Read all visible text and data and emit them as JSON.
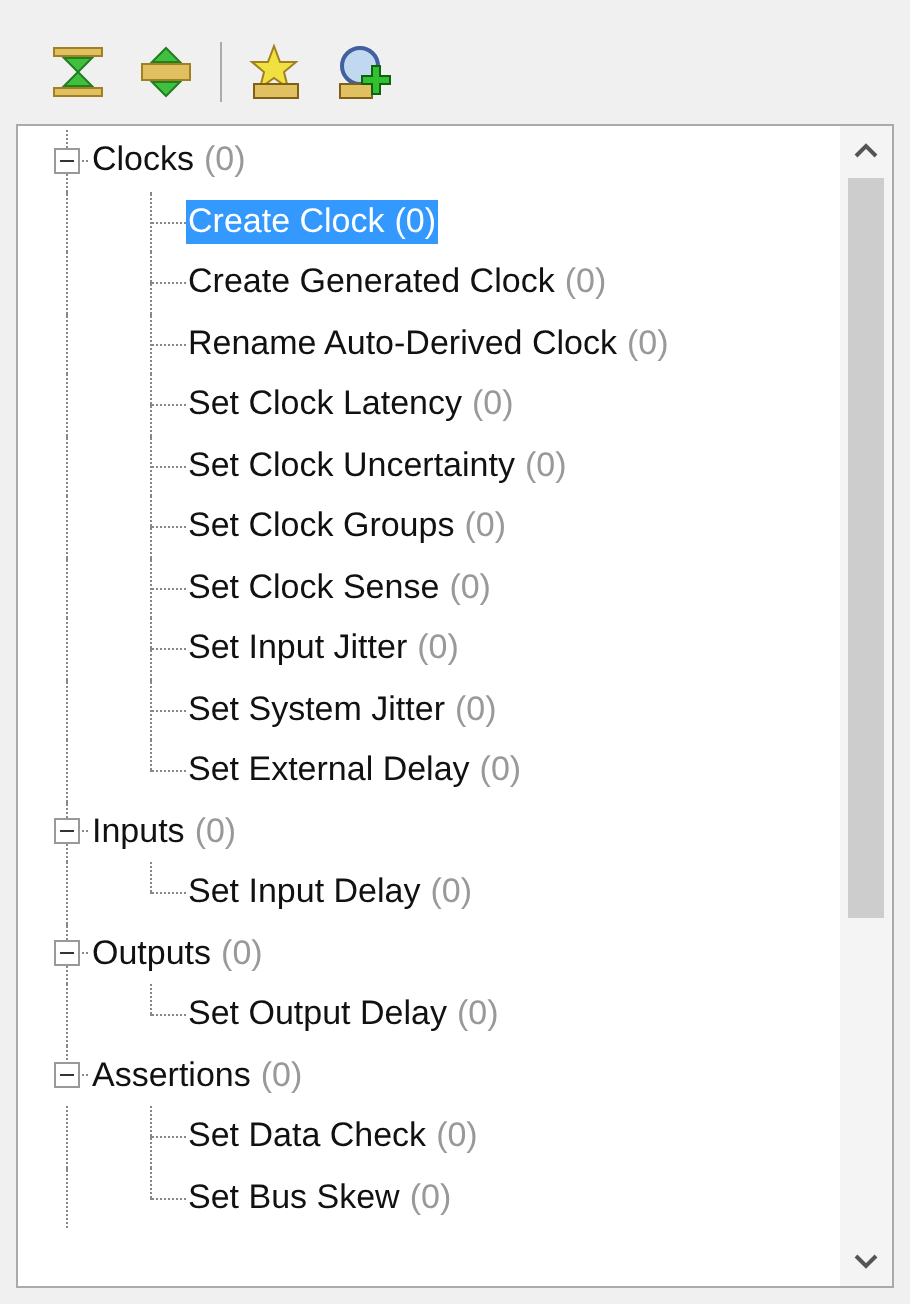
{
  "toolbar": {
    "buttons": [
      {
        "kind": "collapse"
      },
      {
        "kind": "expand"
      },
      {
        "kind": "star"
      },
      {
        "kind": "add"
      }
    ]
  },
  "tree": {
    "nodes": [
      {
        "label": "Clocks",
        "count": "(0)",
        "expanded": true,
        "selected": false,
        "children": [
          {
            "label": "Create Clock",
            "count": "(0)",
            "selected": true
          },
          {
            "label": "Create Generated Clock",
            "count": "(0)",
            "selected": false
          },
          {
            "label": "Rename Auto-Derived Clock",
            "count": "(0)",
            "selected": false
          },
          {
            "label": "Set Clock Latency",
            "count": "(0)",
            "selected": false
          },
          {
            "label": "Set Clock Uncertainty",
            "count": "(0)",
            "selected": false
          },
          {
            "label": "Set Clock Groups",
            "count": "(0)",
            "selected": false
          },
          {
            "label": "Set Clock Sense",
            "count": "(0)",
            "selected": false
          },
          {
            "label": "Set Input Jitter",
            "count": "(0)",
            "selected": false
          },
          {
            "label": "Set System Jitter",
            "count": "(0)",
            "selected": false
          },
          {
            "label": "Set External Delay",
            "count": "(0)",
            "selected": false
          }
        ]
      },
      {
        "label": "Inputs",
        "count": "(0)",
        "expanded": true,
        "selected": false,
        "children": [
          {
            "label": "Set Input Delay",
            "count": "(0)",
            "selected": false
          }
        ]
      },
      {
        "label": "Outputs",
        "count": "(0)",
        "expanded": true,
        "selected": false,
        "children": [
          {
            "label": "Set Output Delay",
            "count": "(0)",
            "selected": false
          }
        ]
      },
      {
        "label": "Assertions",
        "count": "(0)",
        "expanded": true,
        "selected": false,
        "children": [
          {
            "label": "Set Data Check",
            "count": "(0)",
            "selected": false
          },
          {
            "label": "Set Bus Skew",
            "count": "(0)",
            "selected": false
          }
        ]
      }
    ]
  }
}
